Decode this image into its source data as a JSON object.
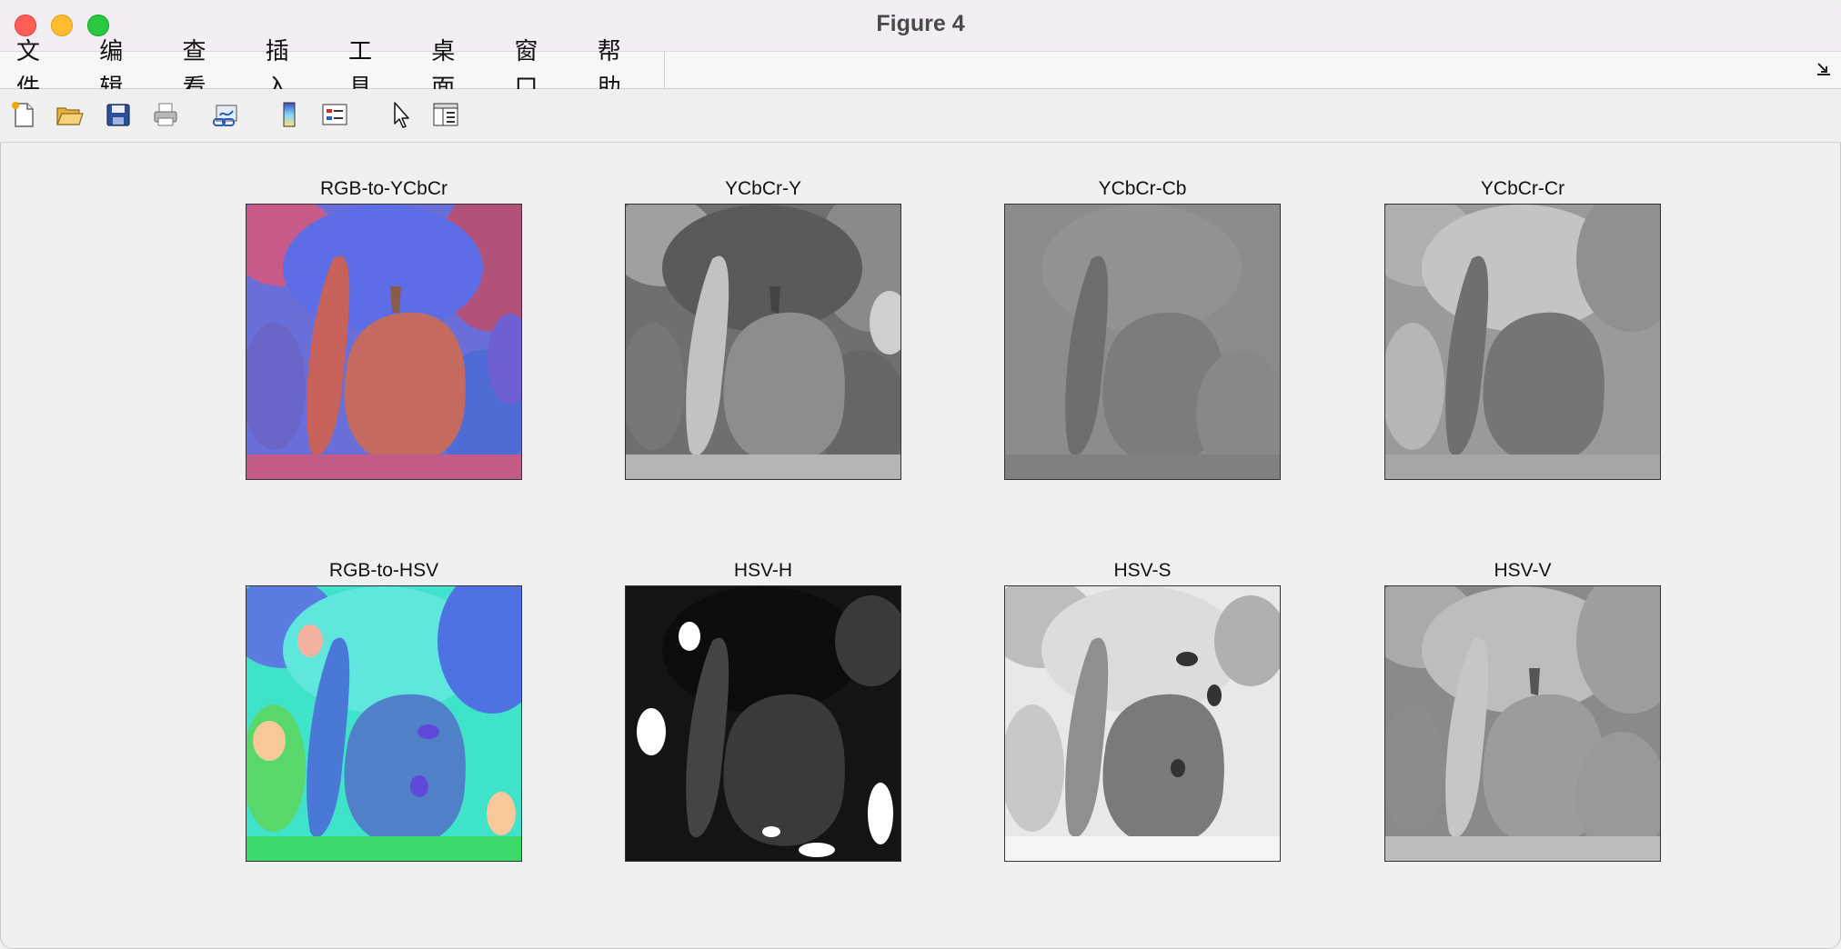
{
  "window": {
    "title": "Figure 4"
  },
  "menu": {
    "items": [
      "文件",
      "编辑",
      "查看",
      "插入",
      "工具",
      "桌面",
      "窗口",
      "帮助"
    ]
  },
  "toolbar": {
    "icons": [
      "new-figure-icon",
      "open-file-icon",
      "save-icon",
      "print-icon",
      "link-plot-icon",
      "insert-colorbar-icon",
      "insert-legend-icon",
      "edit-plot-arrow-icon",
      "property-inspector-icon"
    ]
  },
  "panels": [
    {
      "title": "RGB-to-YCbCr"
    },
    {
      "title": "YCbCr-Y"
    },
    {
      "title": "YCbCr-Cb"
    },
    {
      "title": "YCbCr-Cr"
    },
    {
      "title": "RGB-to-HSV"
    },
    {
      "title": "HSV-H"
    },
    {
      "title": "HSV-S"
    },
    {
      "title": "HSV-V"
    }
  ],
  "colors": {
    "window_bg": "#f0f0f0",
    "titlebar_bg": "#f3eef3",
    "close": "#fe5f57",
    "minimize": "#febc2e",
    "zoom": "#28c840"
  }
}
